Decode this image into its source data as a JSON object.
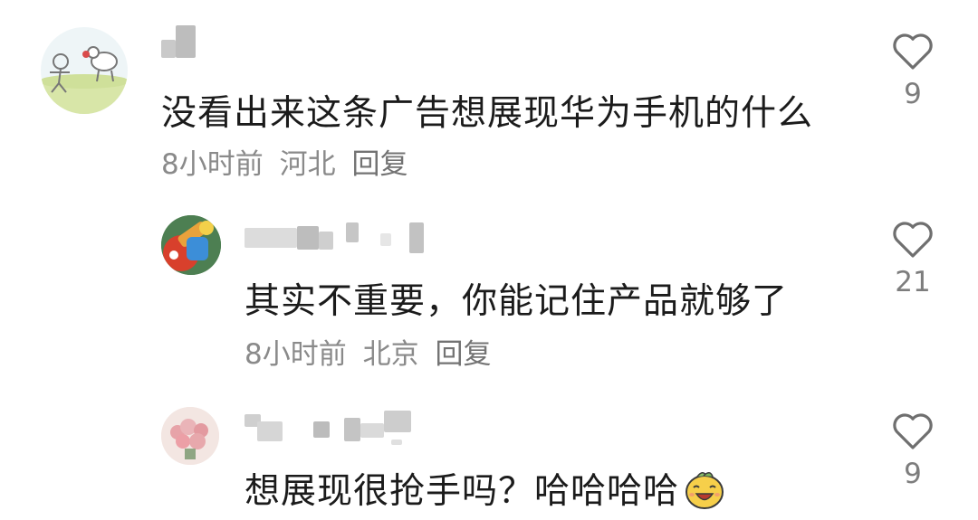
{
  "comments": [
    {
      "text": "没看出来这条广告想展现华为手机的什么",
      "time": "8小时前",
      "location": "河北",
      "reply_label": "回复",
      "likes": "9"
    },
    {
      "text": "其实不重要，你能记住产品就够了",
      "time": "8小时前",
      "location": "北京",
      "reply_label": "回复",
      "likes": "21"
    },
    {
      "text": "想展现很抢手吗？哈哈哈哈",
      "likes": "9"
    }
  ],
  "icons": {
    "like": "heart-outline-icon",
    "emoji": "laughing-face-emoji"
  },
  "colors": {
    "text": "#1b1b1b",
    "meta": "#8a8a8a",
    "icon": "#6f6f6f"
  }
}
